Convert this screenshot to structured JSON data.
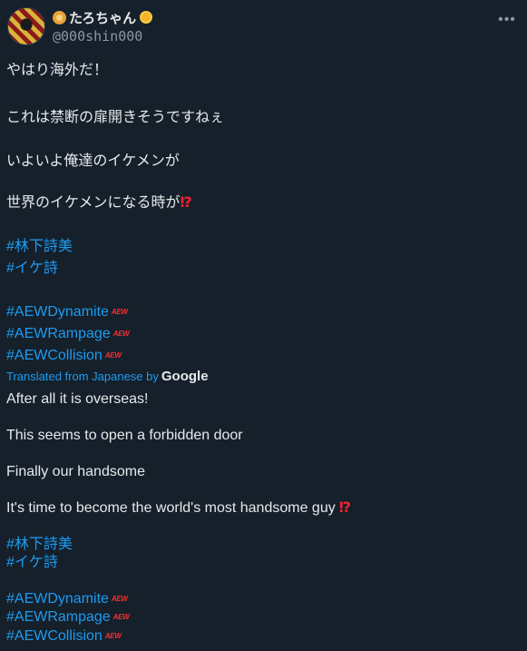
{
  "user": {
    "display_name": "たろちゃん",
    "handle": "@000shin000"
  },
  "icons": {
    "more": "more-options-icon",
    "lion": "lion-emoji",
    "sun": "sun-emoji",
    "interrobang": "interrobang-emoji"
  },
  "tweet": {
    "jp_line1": "やはり海外だ！",
    "jp_line2": "これは禁断の扉開きそうですねぇ",
    "jp_line3": "いよいよ俺達のイケメンが",
    "jp_line4": "世界のイケメンになる時が",
    "interrobang": "⁉",
    "hashtags_a": [
      "#林下詩美",
      "#イケ詩"
    ],
    "hashtags_b": [
      "#AEWDynamite",
      "#AEWRampage",
      "#AEWCollision"
    ],
    "aew_badge": "AEW",
    "translated_label": "Translated from Japanese by",
    "translator": "Google",
    "en_line1": "After all it is overseas!",
    "en_line2": "This seems to open a forbidden door",
    "en_line3": "Finally our handsome",
    "en_line4": "It's time to become the world's most handsome guy"
  },
  "colors": {
    "background": "#15202b",
    "link": "#1d9bf0",
    "text": "#e7e9ea",
    "muted": "#8b98a5",
    "accent_red": "#f4212e"
  }
}
